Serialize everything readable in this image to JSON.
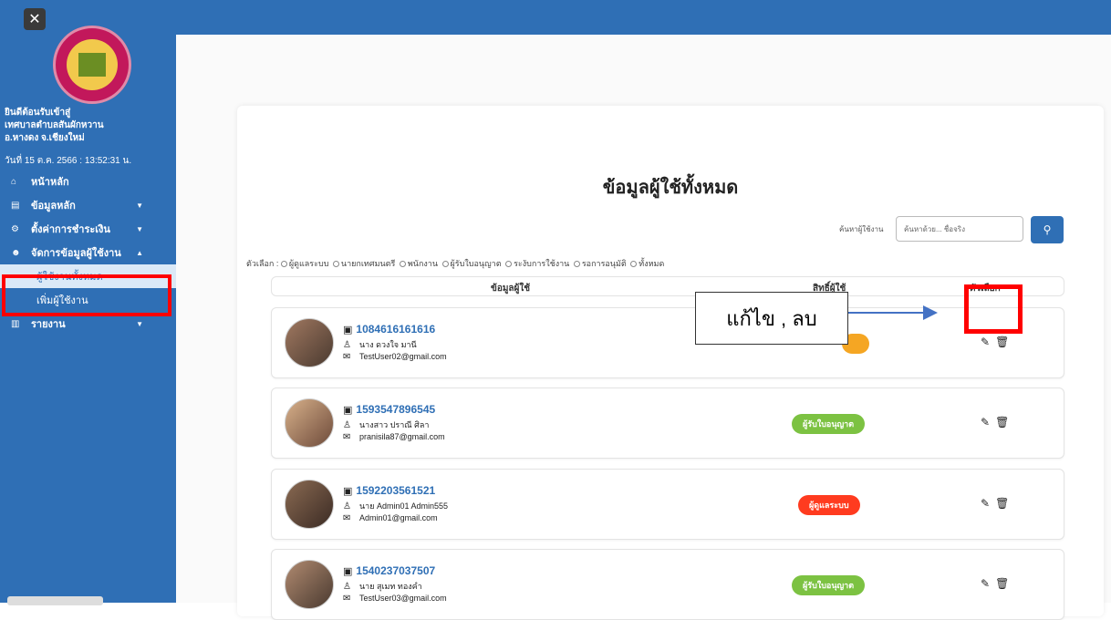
{
  "sidebar": {
    "close_label": "✕",
    "welcome_line1": "ยินดีต้อนรับเข้าสู่",
    "welcome_line2": "เทศบาลตำบลสันผักหวาน",
    "welcome_line3": "อ.หางดง จ.เชียงใหม่",
    "date": "วันที่ 15 ต.ค. 2566 : 13:52:31 น.",
    "items": [
      {
        "label": "หน้าหลัก",
        "icon": "home-icon",
        "glyph": "⌂"
      },
      {
        "label": "ข้อมูลหลัก",
        "icon": "database-icon",
        "glyph": "▤"
      },
      {
        "label": "ตั้งค่าการชำระเงิน",
        "icon": "gear-icon",
        "glyph": "⚙"
      },
      {
        "label": "จัดการข้อมูลผู้ใช้งาน",
        "icon": "users-icon",
        "glyph": "☻"
      }
    ],
    "sub_items": [
      {
        "label": "ผู้ใช้งานทั้งหมด"
      },
      {
        "label": "เพิ่มผู้ใช้งาน"
      }
    ],
    "report_label": "รายงาน",
    "report_glyph": "▥"
  },
  "main": {
    "title": "ข้อมูลผู้ใช้ทั้งหมด",
    "search_label": "ค้นหาผู้ใช้งาน",
    "search_placeholder": "ค้นหาด้วย... ชื่อจริง",
    "filter_prefix": "ตัวเลือก :",
    "filters": [
      "ผู้ดูแลระบบ",
      "นายกเทศมนตรี",
      "พนักงาน",
      "ผู้รับใบอนุญาต",
      "ระงับการใช้งาน",
      "รอการอนุมัติ",
      "ทั้งหมด"
    ],
    "headers": {
      "user": "ข้อมูลผู้ใช้",
      "role": "สิทธิ์ผู้ใช้",
      "options": "ตัวเลือก"
    }
  },
  "users": [
    {
      "id": "1084616161616",
      "name": "นาง ดวงใจ มานี",
      "email": "TestUser02@gmail.com",
      "role": "",
      "role_color": "#f5a623"
    },
    {
      "id": "1593547896545",
      "name": "นางสาว ปราณี ศิลา",
      "email": "pranisila87@gmail.com",
      "role": "ผู้รับใบอนุญาต",
      "role_color": "#7cc242"
    },
    {
      "id": "1592203561521",
      "name": "นาย Admin01 Admin555",
      "email": "Admin01@gmail.com",
      "role": "ผู้ดูแลระบบ",
      "role_color": "#ff3b1f"
    },
    {
      "id": "1540237037507",
      "name": "นาย สุเมท ทองคำ",
      "email": "TestUser03@gmail.com",
      "role": "ผู้รับใบอนุญาต",
      "role_color": "#7cc242"
    }
  ],
  "annotation": {
    "text": "แก้ไข , ลบ"
  }
}
